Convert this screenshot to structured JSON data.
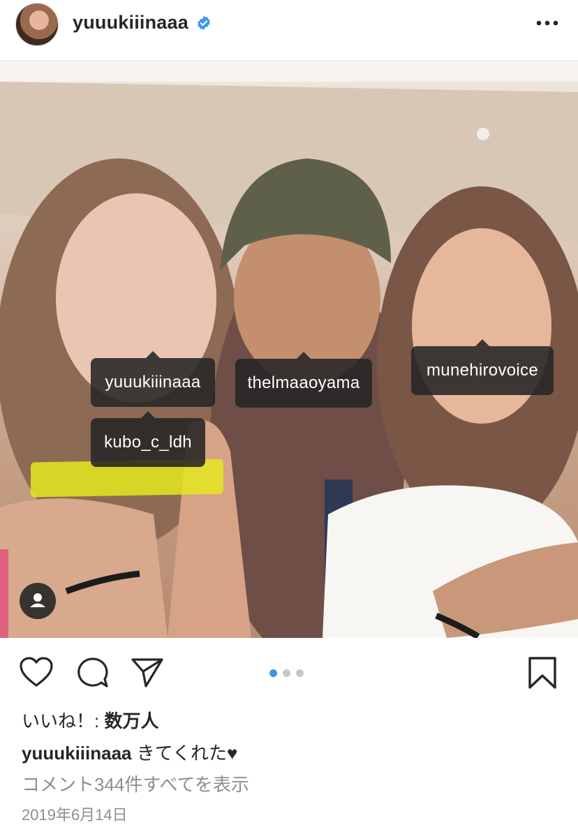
{
  "header": {
    "username": "yuuukiiinaaa",
    "verified_color": "#3897f0",
    "more_icon": "more-horizontal-icon"
  },
  "photo": {
    "tags": [
      {
        "label": "yuuukiiinaaa"
      },
      {
        "label": "thelmaaoyama"
      },
      {
        "label": "munehirovoice"
      },
      {
        "label": "kubo_c_ldh"
      }
    ],
    "user_badge_icon": "person-icon",
    "highlight_color": "#e4e81e"
  },
  "actions": {
    "like_icon": "heart-icon",
    "comment_icon": "comment-icon",
    "share_icon": "send-icon",
    "save_icon": "bookmark-icon",
    "carousel": {
      "count": 3,
      "active": 1,
      "active_color": "#3897f0"
    }
  },
  "post": {
    "likes_prefix": "いいね！: ",
    "likes_count": "数万人",
    "caption_user": "yuuukiiinaaa",
    "caption_text": "きてくれた♥",
    "view_comments": "コメント344件すべてを表示",
    "date": "2019年6月14日"
  }
}
